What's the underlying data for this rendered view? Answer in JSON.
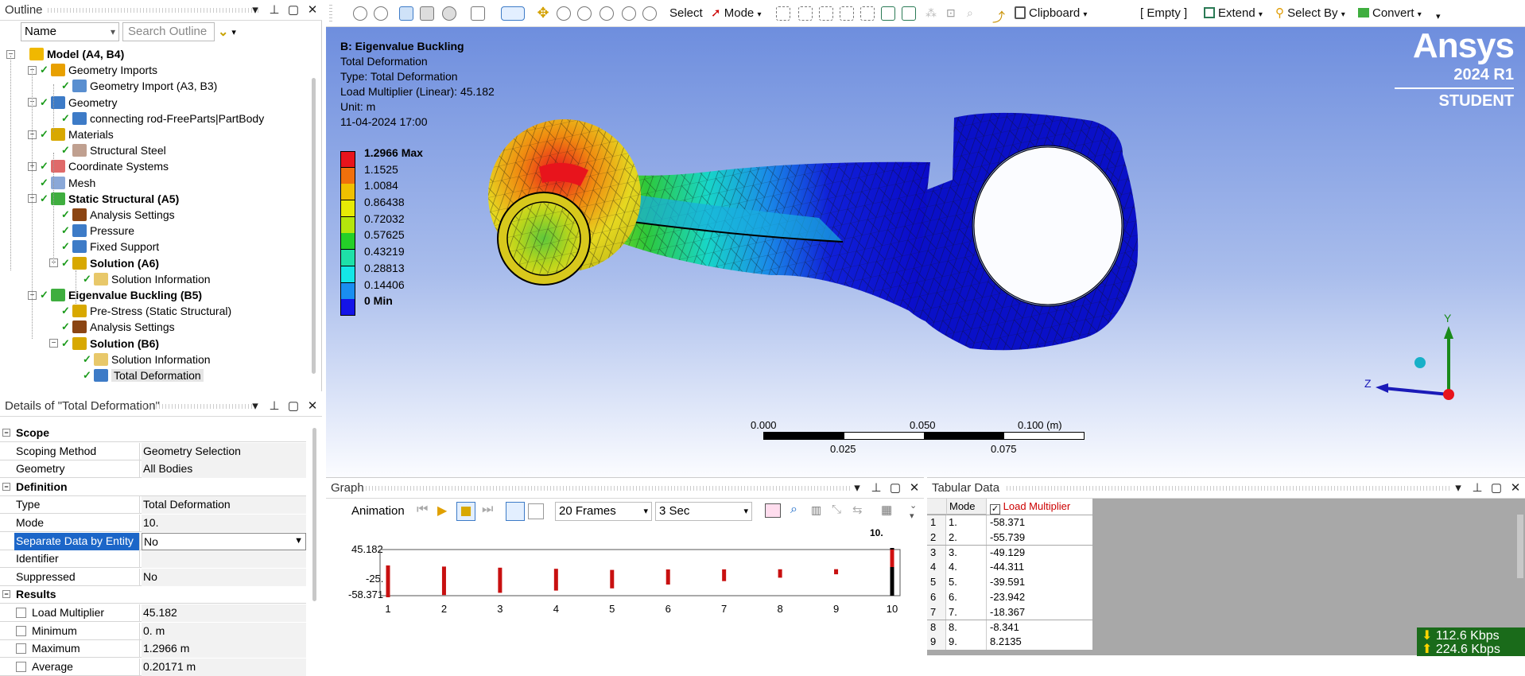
{
  "outline": {
    "title": "Outline",
    "filter_value": "Name",
    "search_placeholder": "Search Outline",
    "tree": [
      {
        "label": "Model (A4, B4)",
        "bold": true,
        "depth": 0
      },
      {
        "label": "Geometry Imports",
        "bold": false,
        "depth": 1
      },
      {
        "label": "Geometry Import (A3, B3)",
        "bold": false,
        "depth": 2
      },
      {
        "label": "Geometry",
        "bold": false,
        "depth": 1
      },
      {
        "label": "connecting rod-FreeParts|PartBody",
        "bold": false,
        "depth": 2
      },
      {
        "label": "Materials",
        "bold": false,
        "depth": 1
      },
      {
        "label": "Structural Steel",
        "bold": false,
        "depth": 2
      },
      {
        "label": "Coordinate Systems",
        "bold": false,
        "depth": 1
      },
      {
        "label": "Mesh",
        "bold": false,
        "depth": 1
      },
      {
        "label": "Static Structural (A5)",
        "bold": true,
        "depth": 1
      },
      {
        "label": "Analysis Settings",
        "bold": false,
        "depth": 2
      },
      {
        "label": "Pressure",
        "bold": false,
        "depth": 2
      },
      {
        "label": "Fixed Support",
        "bold": false,
        "depth": 2
      },
      {
        "label": "Solution (A6)",
        "bold": true,
        "depth": 2
      },
      {
        "label": "Solution Information",
        "bold": false,
        "depth": 3
      },
      {
        "label": "Eigenvalue Buckling (B5)",
        "bold": true,
        "depth": 1
      },
      {
        "label": "Pre-Stress (Static Structural)",
        "bold": false,
        "depth": 2
      },
      {
        "label": "Analysis Settings",
        "bold": false,
        "depth": 2
      },
      {
        "label": "Solution (B6)",
        "bold": true,
        "depth": 2
      },
      {
        "label": "Solution Information",
        "bold": false,
        "depth": 3
      },
      {
        "label": "Total Deformation",
        "bold": false,
        "depth": 3
      }
    ]
  },
  "details": {
    "title": "Details of \"Total Deformation\"",
    "rows": [
      {
        "type": "cat",
        "key": "Scope"
      },
      {
        "type": "row",
        "key": "Scoping Method",
        "value": "Geometry Selection"
      },
      {
        "type": "row",
        "key": "Geometry",
        "value": "All Bodies"
      },
      {
        "type": "cat",
        "key": "Definition"
      },
      {
        "type": "row",
        "key": "Type",
        "value": "Total Deformation"
      },
      {
        "type": "row",
        "key": "Mode",
        "value": "10."
      },
      {
        "type": "sel",
        "key": "Separate Data by Entity",
        "value": "No"
      },
      {
        "type": "row",
        "key": "Identifier",
        "value": ""
      },
      {
        "type": "row",
        "key": "Suppressed",
        "value": "No"
      },
      {
        "type": "cat",
        "key": "Results"
      },
      {
        "type": "chk",
        "key": "Load Multiplier",
        "value": "45.182"
      },
      {
        "type": "chk",
        "key": "Minimum",
        "value": "0. m"
      },
      {
        "type": "chk",
        "key": "Maximum",
        "value": "1.2966 m"
      },
      {
        "type": "chk",
        "key": "Average",
        "value": "0.20171 m"
      }
    ]
  },
  "toolbar": {
    "select_label": "Select",
    "mode_label": "Mode",
    "clipboard_label": "Clipboard",
    "empty_label": "[ Empty ]",
    "extend_label": "Extend",
    "selectby_label": "Select By",
    "convert_label": "Convert"
  },
  "viewport": {
    "title": "B: Eigenvalue Buckling",
    "line1": "Total Deformation",
    "line2": "Type: Total Deformation",
    "line3": "Load Multiplier (Linear): 45.182",
    "line4": "Unit: m",
    "line5": "11-04-2024 17:00",
    "brand": "Ansys",
    "version": "2024 R1",
    "edition": "STUDENT",
    "legend": [
      {
        "label": "1.2966 Max",
        "color": "#e8141c"
      },
      {
        "label": "1.1525",
        "color": "#f0700c"
      },
      {
        "label": "1.0084",
        "color": "#f0c000"
      },
      {
        "label": "0.86438",
        "color": "#e6ea06"
      },
      {
        "label": "0.72032",
        "color": "#b4e60c"
      },
      {
        "label": "0.57625",
        "color": "#24d028"
      },
      {
        "label": "0.43219",
        "color": "#1ee0a8"
      },
      {
        "label": "0.28813",
        "color": "#14e6e6"
      },
      {
        "label": "0.14406",
        "color": "#1a8ef0"
      },
      {
        "label": "0 Min",
        "color": "#1414e8"
      }
    ],
    "scale_top": [
      "0.000",
      "0.050",
      "0.100 (m)"
    ],
    "scale_bottom": [
      "0.025",
      "0.075"
    ],
    "axis_y": "Y",
    "axis_z": "Z"
  },
  "graph": {
    "title": "Graph",
    "animation_label": "Animation",
    "frames": "20 Frames",
    "duration": "3 Sec",
    "y_top": "45.182",
    "y_mid": "-25.",
    "y_bot": "-58.371",
    "x_ticks": [
      "1",
      "2",
      "3",
      "4",
      "5",
      "6",
      "7",
      "8",
      "9",
      "10"
    ],
    "marker": "10."
  },
  "chart_data": {
    "type": "bar",
    "categories": [
      "1",
      "2",
      "3",
      "4",
      "5",
      "6",
      "7",
      "8",
      "9",
      "10"
    ],
    "values": [
      -58.371,
      -55.739,
      -49.129,
      -44.311,
      -39.591,
      -23.942,
      -18.367,
      -8.341,
      8.2135,
      45.182
    ],
    "title": "",
    "xlabel": "",
    "ylabel": "",
    "ylim": [
      -58.371,
      45.182
    ]
  },
  "tabular": {
    "title": "Tabular Data",
    "col_mode": "Mode",
    "col_lm": "Load Multiplier",
    "rows": [
      {
        "n": "1",
        "mode": "1.",
        "lm": "-58.371"
      },
      {
        "n": "2",
        "mode": "2.",
        "lm": "-55.739"
      },
      {
        "n": "3",
        "mode": "3.",
        "lm": "-49.129"
      },
      {
        "n": "4",
        "mode": "4.",
        "lm": "-44.311"
      },
      {
        "n": "5",
        "mode": "5.",
        "lm": "-39.591"
      },
      {
        "n": "6",
        "mode": "6.",
        "lm": "-23.942"
      },
      {
        "n": "7",
        "mode": "7.",
        "lm": "-18.367"
      },
      {
        "n": "8",
        "mode": "8.",
        "lm": "-8.341"
      },
      {
        "n": "9",
        "mode": "9.",
        "lm": "8.2135"
      }
    ]
  },
  "netspeed": {
    "down": "112.6 Kbps",
    "up": "224.6 Kbps"
  }
}
